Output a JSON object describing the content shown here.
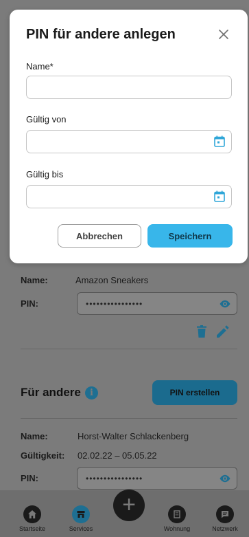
{
  "modal": {
    "title": "PIN für andere anlegen",
    "name_label": "Name*",
    "name_value": "",
    "valid_from_label": "Gültig von",
    "valid_from_value": "",
    "valid_to_label": "Gültig bis",
    "valid_to_value": "",
    "cancel_label": "Abbrechen",
    "save_label": "Speichern"
  },
  "own_pin_entry": {
    "name_label": "Name:",
    "name_value": "Amazon Sneakers",
    "pin_label": "PIN:",
    "pin_masked": "••••••••••••••••"
  },
  "for_others": {
    "section_title": "Für andere",
    "create_button": "PIN erstellen",
    "entry": {
      "name_label": "Name:",
      "name_value": "Horst-Walter Schlackenberg",
      "validity_label": "Gültigkeit:",
      "validity_value": "02.02.22 – 05.05.22",
      "pin_label": "PIN:",
      "pin_masked": "••••••••••••••••"
    }
  },
  "bottom_nav": {
    "items": [
      {
        "label": "Startseite",
        "icon": "home-icon"
      },
      {
        "label": "Services",
        "icon": "store-icon"
      },
      {
        "label": "Wohnung",
        "icon": "building-icon"
      },
      {
        "label": "Netzwerk",
        "icon": "chat-icon"
      }
    ],
    "fab_symbol": "+"
  },
  "colors": {
    "accent": "#38b6ea",
    "overlay": "#7a7a7a"
  }
}
